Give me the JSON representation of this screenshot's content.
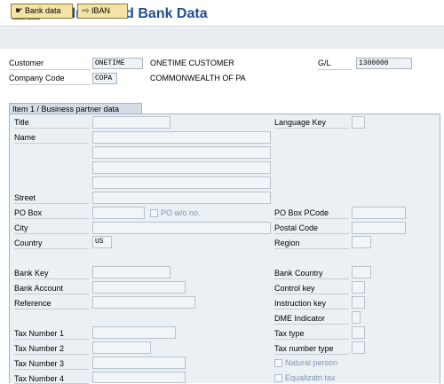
{
  "title": "Address and Bank Data",
  "toolbar": {
    "bank_data": "Bank data",
    "iban": "IBAN"
  },
  "header": {
    "customer_label": "Customer",
    "customer_value": "ONETIME",
    "customer_name": "ONETIME CUSTOMER",
    "gl_label": "G/L",
    "gl_value": "1300000",
    "company_code_label": "Company Code",
    "company_code_value": "COPA",
    "company_name": "COMMONWEALTH OF PA"
  },
  "group": {
    "title": "Item 1 / Business partner data"
  },
  "fields": {
    "title": "Title",
    "name": "Name",
    "street": "Street",
    "po_box": "PO Box",
    "po_wo_no": "PO w/o no.",
    "city": "City",
    "country": "Country",
    "country_value": "US",
    "bank_key": "Bank Key",
    "bank_account": "Bank Account",
    "reference": "Reference",
    "tax_number_1": "Tax Number 1",
    "tax_number_2": "Tax Number 2",
    "tax_number_3": "Tax Number 3",
    "tax_number_4": "Tax Number 4",
    "language_key": "Language Key",
    "po_box_pcode": "PO Box PCode",
    "postal_code": "Postal Code",
    "region": "Region",
    "bank_country": "Bank Country",
    "control_key": "Control key",
    "instruction_key": "Instruction key",
    "dme_indicator": "DME Indicator",
    "tax_type": "Tax type",
    "tax_number_type": "Tax number type",
    "natural_person": "Natural person",
    "equalizatn_tax": "Equalizatn tax"
  },
  "colors": {
    "title": "#1f4f8f",
    "button_bg": "#f5e3a5",
    "group_bg": "#eaf0f4",
    "field_bg": "#f2f5f8",
    "disabled_text": "#7f96b4"
  }
}
